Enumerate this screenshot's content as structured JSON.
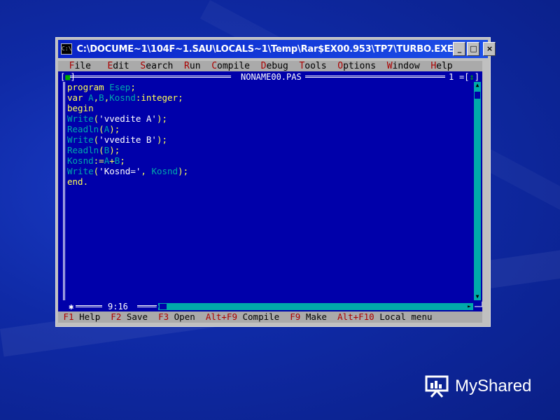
{
  "window": {
    "title": "C:\\DOCUME~1\\104F~1.SAU\\LOCALS~1\\Temp\\Rar$EX00.953\\TP7\\TURBO.EXE",
    "app_icon": "C:\\",
    "controls": {
      "minimize": "_",
      "maximize": "□",
      "close": "×"
    }
  },
  "menu": {
    "items": [
      {
        "hot": "F",
        "rest": "ile"
      },
      {
        "hot": "E",
        "rest": "dit"
      },
      {
        "hot": "S",
        "rest": "earch"
      },
      {
        "hot": "R",
        "rest": "un"
      },
      {
        "hot": "C",
        "rest": "ompile"
      },
      {
        "hot": "D",
        "rest": "ebug"
      },
      {
        "hot": "T",
        "rest": "ools"
      },
      {
        "hot": "O",
        "rest": "ptions"
      },
      {
        "hot": "W",
        "rest": "indow"
      },
      {
        "hot": "H",
        "rest": "elp"
      }
    ]
  },
  "editor": {
    "filename": "NONAME00.PAS",
    "window_number": "1",
    "close_box": "[■]",
    "zoom_box": "[↕]",
    "cursor_position": "9:16",
    "modified_marker": "✱",
    "code": {
      "l1": {
        "a": "program",
        "b": " ",
        "c": "Esep",
        "d": ";"
      },
      "l2": {
        "a": "var",
        "b": " ",
        "c": "A",
        "d": ",",
        "e": "B",
        "f": ",",
        "g": "Kosnd",
        "h": ":",
        "i": "integer",
        "j": ";"
      },
      "l3": {
        "a": "begin"
      },
      "l4": {
        "a": "Write",
        "b": "(",
        "c": "'vvedite A'",
        "d": ");"
      },
      "l5": {
        "a": "Readln",
        "b": "(",
        "c": "A",
        "d": ");"
      },
      "l6": {
        "a": "Write",
        "b": "(",
        "c": "'vvedite B'",
        "d": ");"
      },
      "l7": {
        "a": "Readln",
        "b": "(",
        "c": "B",
        "d": ");"
      },
      "l8": {
        "a": "Kosnd",
        "b": ":=",
        "c": "A",
        "d": "+",
        "e": "B",
        "f": ";"
      },
      "l9": {
        "a": "Write",
        "b": "(",
        "c": "'Kosnd='",
        "d": ", ",
        "e": "Kosnd",
        "f": ");"
      },
      "l10": {
        "a": "end",
        "b": "."
      }
    }
  },
  "status": {
    "items": [
      {
        "key": "F1",
        "label": " Help"
      },
      {
        "key": "F2",
        "label": " Save"
      },
      {
        "key": "F3",
        "label": " Open"
      },
      {
        "key": "Alt+F9",
        "label": " Compile"
      },
      {
        "key": "F9",
        "label": " Make"
      },
      {
        "key": "Alt+F10",
        "label": " Local menu"
      }
    ]
  },
  "watermark": {
    "text": "MyShared"
  },
  "colors": {
    "editor_bg": "#0000aa",
    "menu_bg": "#aaaaaa",
    "hotkey": "#aa0000",
    "keyword": "#ffffff",
    "identifier": "#00aaaa",
    "symbol": "#ffff55",
    "scrollbar": "#00aaaa",
    "titlebar": "#0a24c8"
  }
}
